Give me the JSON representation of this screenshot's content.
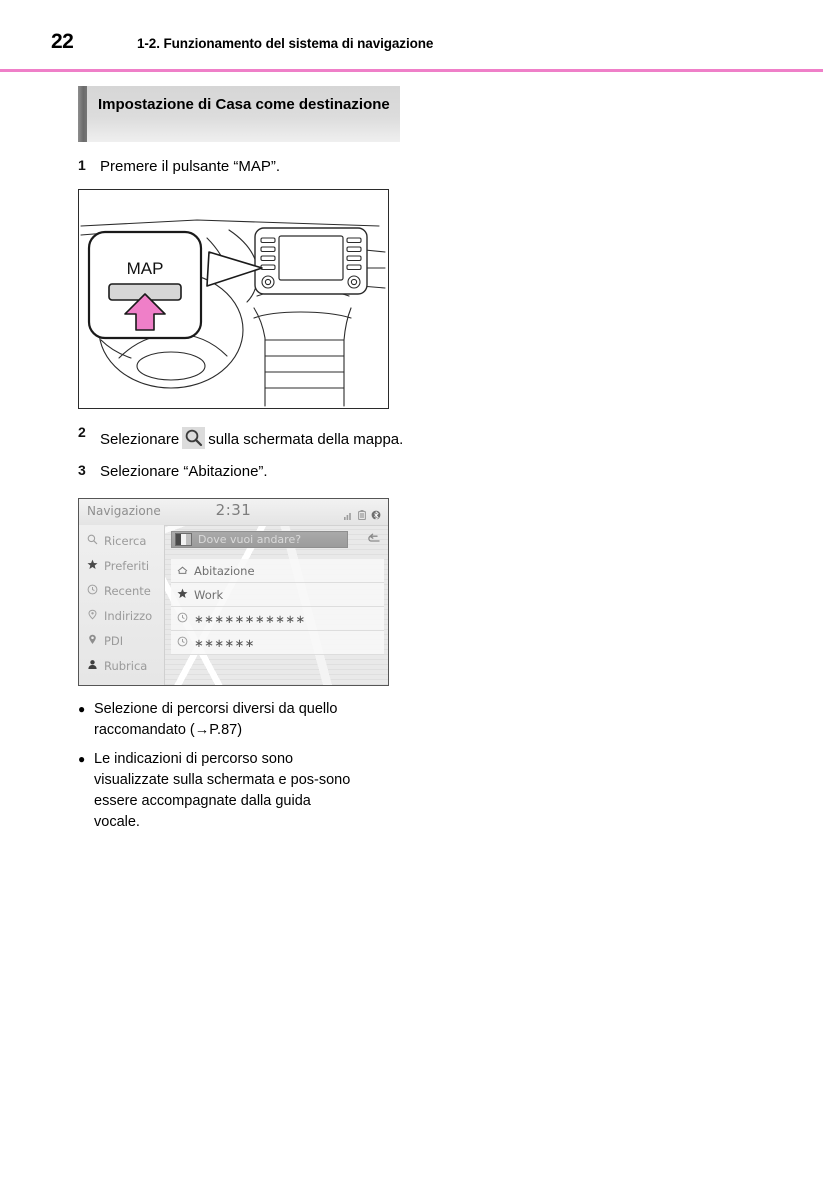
{
  "header": {
    "page_number": "22",
    "title": "1-2. Funzionamento del sistema di navigazione",
    "rule_color": "#ef7fc8"
  },
  "section": {
    "heading": "Impostazione di Casa come destinazione"
  },
  "steps": [
    {
      "number": "1",
      "text": "Premere il pulsante “MAP”."
    },
    {
      "number": "2",
      "text_before": "Selezionare",
      "icon": "search-icon",
      "text_after": "sulla schermata della mappa."
    },
    {
      "number": "3",
      "text": "Selezionare “Abitazione”."
    }
  ],
  "illustration": {
    "callout_label": "MAP",
    "arrow_color": "#ef7fc8",
    "description": "dashboard-line-drawing"
  },
  "nav_screen": {
    "title": "Navigazione",
    "clock": "2:31",
    "status_icons": [
      "signal-icon",
      "battery-icon",
      "bluetooth-icon"
    ],
    "search": {
      "placeholder": "Dove vuoi andare?",
      "back_icon": "back-arrow-icon"
    },
    "sidebar": [
      {
        "icon": "search-icon",
        "label": "Ricerca"
      },
      {
        "icon": "star-icon",
        "label": "Preferiti"
      },
      {
        "icon": "clock-icon",
        "label": "Recente"
      },
      {
        "icon": "address-pin-icon",
        "label": "Indirizzo"
      },
      {
        "icon": "poi-pin-icon",
        "label": "PDI"
      },
      {
        "icon": "contact-icon",
        "label": "Rubrica"
      }
    ],
    "list": [
      {
        "icon": "home-icon",
        "label": "Abitazione"
      },
      {
        "icon": "star-icon",
        "label": "Work"
      },
      {
        "icon": "clock-icon",
        "label": "∗∗∗∗∗∗∗∗∗∗∗"
      },
      {
        "icon": "clock-icon",
        "label": "∗∗∗∗∗∗"
      }
    ]
  },
  "bullets": [
    {
      "dot": "●",
      "text": "Selezione di percorsi diversi da quello raccomandato (→P.87)"
    },
    {
      "dot": "●",
      "text": "Le indicazioni di percorso sono visualizzate sulla schermata e pos-sono essere accompagnate dalla guida vocale."
    }
  ]
}
